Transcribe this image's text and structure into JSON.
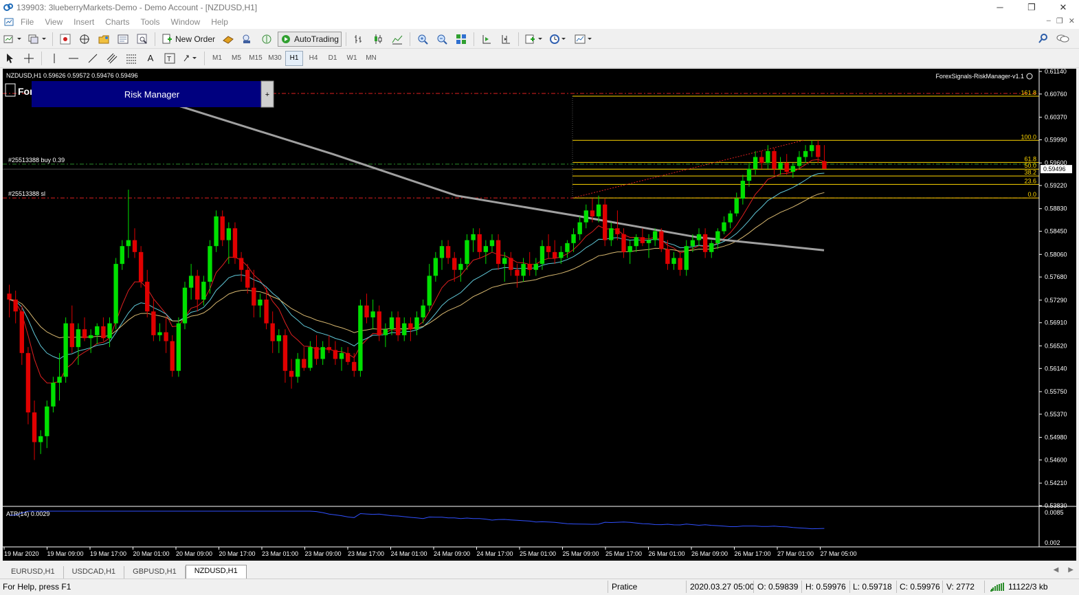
{
  "window": {
    "title": "139903: 3lueberryMarkets-Demo - Demo Account - [NZDUSD,H1]"
  },
  "menu": [
    "File",
    "View",
    "Insert",
    "Charts",
    "Tools",
    "Window",
    "Help"
  ],
  "toolbar": {
    "new_order_label": "New Order",
    "autotrading_label": "AutoTrading",
    "timeframes": [
      "M1",
      "M5",
      "M15",
      "M30",
      "H1",
      "H4",
      "D1",
      "W1",
      "MN"
    ],
    "active_timeframe": "H1"
  },
  "chart": {
    "header": "NZDUSD,H1  0.59626 0.59572 0.59476 0.59496",
    "indicator_name": "ForexSignals-RiskManager-v1.1",
    "risk_manager_label": "Risk Manager",
    "risk_manager_plus": "+",
    "logo_text": "For",
    "order_line_buy": "#25513388 buy 0.39",
    "order_line_sl": "#25513388 sl",
    "current_price": "0.59496",
    "price_axis": [
      "0.61140",
      "0.60760",
      "0.60370",
      "0.59990",
      "0.59600",
      "0.59220",
      "0.58830",
      "0.58450",
      "0.58060",
      "0.57680",
      "0.57290",
      "0.56910",
      "0.56520",
      "0.56140",
      "0.55750",
      "0.55370",
      "0.54980",
      "0.54600",
      "0.54210",
      "0.53830"
    ],
    "fib_levels": [
      "161.8",
      "100.0",
      "61.8",
      "50.0",
      "38.2",
      "23.6",
      "0.0"
    ],
    "time_axis": [
      "19 Mar 2020",
      "19 Mar 09:00",
      "19 Mar 17:00",
      "20 Mar 01:00",
      "20 Mar 09:00",
      "20 Mar 17:00",
      "23 Mar 01:00",
      "23 Mar 09:00",
      "23 Mar 17:00",
      "24 Mar 01:00",
      "24 Mar 09:00",
      "24 Mar 17:00",
      "25 Mar 01:00",
      "25 Mar 09:00",
      "25 Mar 17:00",
      "26 Mar 01:00",
      "26 Mar 09:00",
      "26 Mar 17:00",
      "27 Mar 01:00",
      "27 Mar 05:00"
    ],
    "atr_label": "ATR(14) 0.0029",
    "atr_axis": [
      "0.0085",
      "0.002"
    ],
    "colors": {
      "bull": "#00e000",
      "bear": "#e00000",
      "background": "#000000",
      "fib": "#ffd700",
      "ma_red": "#e02020",
      "ma_cyan": "#60c8d8",
      "ma_tan": "#d8b870",
      "ma_gray": "#a0a0a0",
      "atr": "#3050ff",
      "panel": "#00007f"
    }
  },
  "chart_data": {
    "type": "candlestick",
    "symbol": "NZDUSD",
    "timeframe": "H1",
    "ylim": [
      0.5383,
      0.6114
    ],
    "last": {
      "open": 0.59626,
      "high": 0.59572,
      "low": 0.59476,
      "close": 0.59496
    },
    "candles": [
      [
        0.574,
        0.5755,
        0.57,
        0.573
      ],
      [
        0.573,
        0.5745,
        0.569,
        0.571
      ],
      [
        0.571,
        0.572,
        0.562,
        0.564
      ],
      [
        0.564,
        0.565,
        0.552,
        0.554
      ],
      [
        0.554,
        0.556,
        0.546,
        0.549
      ],
      [
        0.549,
        0.551,
        0.547,
        0.55
      ],
      [
        0.55,
        0.556,
        0.548,
        0.555
      ],
      [
        0.555,
        0.56,
        0.554,
        0.559
      ],
      [
        0.559,
        0.564,
        0.556,
        0.56
      ],
      [
        0.56,
        0.57,
        0.559,
        0.569
      ],
      [
        0.569,
        0.572,
        0.564,
        0.565
      ],
      [
        0.565,
        0.569,
        0.562,
        0.568
      ],
      [
        0.568,
        0.57,
        0.566,
        0.5665
      ],
      [
        0.5665,
        0.568,
        0.564,
        0.567
      ],
      [
        0.567,
        0.569,
        0.5655,
        0.5685
      ],
      [
        0.5685,
        0.57,
        0.566,
        0.5665
      ],
      [
        0.5665,
        0.57,
        0.565,
        0.569
      ],
      [
        0.569,
        0.58,
        0.568,
        0.579
      ],
      [
        0.579,
        0.583,
        0.578,
        0.582
      ],
      [
        0.582,
        0.5915,
        0.58,
        0.583
      ],
      [
        0.583,
        0.585,
        0.58,
        0.581
      ],
      [
        0.581,
        0.582,
        0.575,
        0.576
      ],
      [
        0.576,
        0.578,
        0.57,
        0.571
      ],
      [
        0.571,
        0.573,
        0.566,
        0.567
      ],
      [
        0.567,
        0.569,
        0.566,
        0.5675
      ],
      [
        0.5675,
        0.57,
        0.564,
        0.566
      ],
      [
        0.566,
        0.567,
        0.56,
        0.561
      ],
      [
        0.561,
        0.57,
        0.56,
        0.569
      ],
      [
        0.569,
        0.576,
        0.568,
        0.575
      ],
      [
        0.575,
        0.579,
        0.573,
        0.577
      ],
      [
        0.577,
        0.578,
        0.571,
        0.573
      ],
      [
        0.573,
        0.577,
        0.572,
        0.576
      ],
      [
        0.576,
        0.583,
        0.574,
        0.582
      ],
      [
        0.582,
        0.588,
        0.581,
        0.587
      ],
      [
        0.587,
        0.588,
        0.582,
        0.583
      ],
      [
        0.583,
        0.586,
        0.579,
        0.585
      ],
      [
        0.585,
        0.586,
        0.579,
        0.58
      ],
      [
        0.58,
        0.581,
        0.576,
        0.578
      ],
      [
        0.578,
        0.579,
        0.574,
        0.575
      ],
      [
        0.575,
        0.578,
        0.57,
        0.572
      ],
      [
        0.572,
        0.574,
        0.57,
        0.573
      ],
      [
        0.573,
        0.575,
        0.568,
        0.569
      ],
      [
        0.569,
        0.571,
        0.564,
        0.566
      ],
      [
        0.566,
        0.568,
        0.564,
        0.567
      ],
      [
        0.567,
        0.568,
        0.559,
        0.561
      ],
      [
        0.561,
        0.563,
        0.558,
        0.56
      ],
      [
        0.56,
        0.564,
        0.559,
        0.563
      ],
      [
        0.563,
        0.565,
        0.561,
        0.5615
      ],
      [
        0.5615,
        0.566,
        0.561,
        0.565
      ],
      [
        0.565,
        0.567,
        0.562,
        0.563
      ],
      [
        0.563,
        0.566,
        0.562,
        0.565
      ],
      [
        0.565,
        0.567,
        0.564,
        0.5645
      ],
      [
        0.5645,
        0.566,
        0.562,
        0.563
      ],
      [
        0.563,
        0.565,
        0.561,
        0.564
      ],
      [
        0.564,
        0.565,
        0.562,
        0.5625
      ],
      [
        0.5625,
        0.564,
        0.56,
        0.561
      ],
      [
        0.561,
        0.573,
        0.56,
        0.572
      ],
      [
        0.572,
        0.574,
        0.569,
        0.57
      ],
      [
        0.57,
        0.573,
        0.568,
        0.571
      ],
      [
        0.571,
        0.572,
        0.566,
        0.567
      ],
      [
        0.567,
        0.569,
        0.565,
        0.568
      ],
      [
        0.568,
        0.571,
        0.567,
        0.57
      ],
      [
        0.57,
        0.571,
        0.566,
        0.567
      ],
      [
        0.567,
        0.57,
        0.566,
        0.569
      ],
      [
        0.569,
        0.57,
        0.566,
        0.568
      ],
      [
        0.568,
        0.571,
        0.567,
        0.57
      ],
      [
        0.57,
        0.573,
        0.569,
        0.572
      ],
      [
        0.572,
        0.579,
        0.571,
        0.577
      ],
      [
        0.577,
        0.581,
        0.576,
        0.58
      ],
      [
        0.58,
        0.583,
        0.578,
        0.582
      ],
      [
        0.582,
        0.583,
        0.579,
        0.58
      ],
      [
        0.58,
        0.581,
        0.576,
        0.578
      ],
      [
        0.578,
        0.58,
        0.576,
        0.579
      ],
      [
        0.579,
        0.584,
        0.578,
        0.583
      ],
      [
        0.583,
        0.585,
        0.581,
        0.584
      ],
      [
        0.584,
        0.585,
        0.58,
        0.581
      ],
      [
        0.581,
        0.583,
        0.579,
        0.582
      ],
      [
        0.582,
        0.584,
        0.581,
        0.583
      ],
      [
        0.583,
        0.584,
        0.578,
        0.579
      ],
      [
        0.579,
        0.581,
        0.576,
        0.58
      ],
      [
        0.58,
        0.581,
        0.577,
        0.578
      ],
      [
        0.578,
        0.579,
        0.575,
        0.577
      ],
      [
        0.577,
        0.58,
        0.576,
        0.579
      ],
      [
        0.579,
        0.581,
        0.577,
        0.578
      ],
      [
        0.578,
        0.58,
        0.577,
        0.579
      ],
      [
        0.579,
        0.583,
        0.578,
        0.582
      ],
      [
        0.582,
        0.584,
        0.58,
        0.581
      ],
      [
        0.581,
        0.583,
        0.579,
        0.58
      ],
      [
        0.58,
        0.582,
        0.579,
        0.581
      ],
      [
        0.581,
        0.583,
        0.58,
        0.5825
      ],
      [
        0.5825,
        0.585,
        0.581,
        0.584
      ],
      [
        0.584,
        0.587,
        0.583,
        0.586
      ],
      [
        0.586,
        0.589,
        0.585,
        0.588
      ],
      [
        0.588,
        0.59,
        0.586,
        0.587
      ],
      [
        0.587,
        0.5905,
        0.586,
        0.589
      ],
      [
        0.589,
        0.59,
        0.582,
        0.583
      ],
      [
        0.583,
        0.586,
        0.582,
        0.585
      ],
      [
        0.585,
        0.588,
        0.583,
        0.584
      ],
      [
        0.584,
        0.585,
        0.58,
        0.581
      ],
      [
        0.581,
        0.583,
        0.579,
        0.582
      ],
      [
        0.582,
        0.584,
        0.581,
        0.5835
      ],
      [
        0.5835,
        0.585,
        0.582,
        0.5825
      ],
      [
        0.5825,
        0.584,
        0.58,
        0.583
      ],
      [
        0.583,
        0.585,
        0.582,
        0.5845
      ],
      [
        0.5845,
        0.585,
        0.581,
        0.5815
      ],
      [
        0.5815,
        0.583,
        0.578,
        0.579
      ],
      [
        0.579,
        0.581,
        0.578,
        0.58
      ],
      [
        0.58,
        0.581,
        0.577,
        0.578
      ],
      [
        0.578,
        0.583,
        0.577,
        0.582
      ],
      [
        0.582,
        0.584,
        0.581,
        0.583
      ],
      [
        0.583,
        0.585,
        0.582,
        0.584
      ],
      [
        0.584,
        0.585,
        0.58,
        0.581
      ],
      [
        0.581,
        0.583,
        0.58,
        0.5825
      ],
      [
        0.5825,
        0.585,
        0.5815,
        0.5845
      ],
      [
        0.5845,
        0.587,
        0.584,
        0.586
      ],
      [
        0.586,
        0.588,
        0.585,
        0.5875
      ],
      [
        0.5875,
        0.591,
        0.587,
        0.59
      ],
      [
        0.59,
        0.594,
        0.589,
        0.593
      ],
      [
        0.593,
        0.596,
        0.592,
        0.595
      ],
      [
        0.595,
        0.598,
        0.594,
        0.597
      ],
      [
        0.597,
        0.598,
        0.595,
        0.596
      ],
      [
        0.596,
        0.599,
        0.595,
        0.598
      ],
      [
        0.598,
        0.5985,
        0.594,
        0.595
      ],
      [
        0.595,
        0.597,
        0.594,
        0.596
      ],
      [
        0.596,
        0.5975,
        0.594,
        0.5945
      ],
      [
        0.5945,
        0.596,
        0.5935,
        0.5955
      ],
      [
        0.5955,
        0.598,
        0.595,
        0.597
      ],
      [
        0.597,
        0.599,
        0.596,
        0.598
      ],
      [
        0.598,
        0.5998,
        0.597,
        0.599
      ],
      [
        0.599,
        0.5998,
        0.596,
        0.597
      ],
      [
        0.5963,
        0.599,
        0.595,
        0.595
      ]
    ]
  },
  "tabs": [
    "EURUSD,H1",
    "USDCAD,H1",
    "GBPUSD,H1",
    "NZDUSD,H1"
  ],
  "active_tab": "NZDUSD,H1",
  "status": {
    "help": "For Help, press F1",
    "profile": "Pratice",
    "datetime": "2020.03.27 05:00",
    "open": "O: 0.59839",
    "high": "H: 0.59976",
    "low": "L: 0.59718",
    "close": "C: 0.59976",
    "volume": "V: 2772",
    "traffic": "11122/3 kb"
  }
}
